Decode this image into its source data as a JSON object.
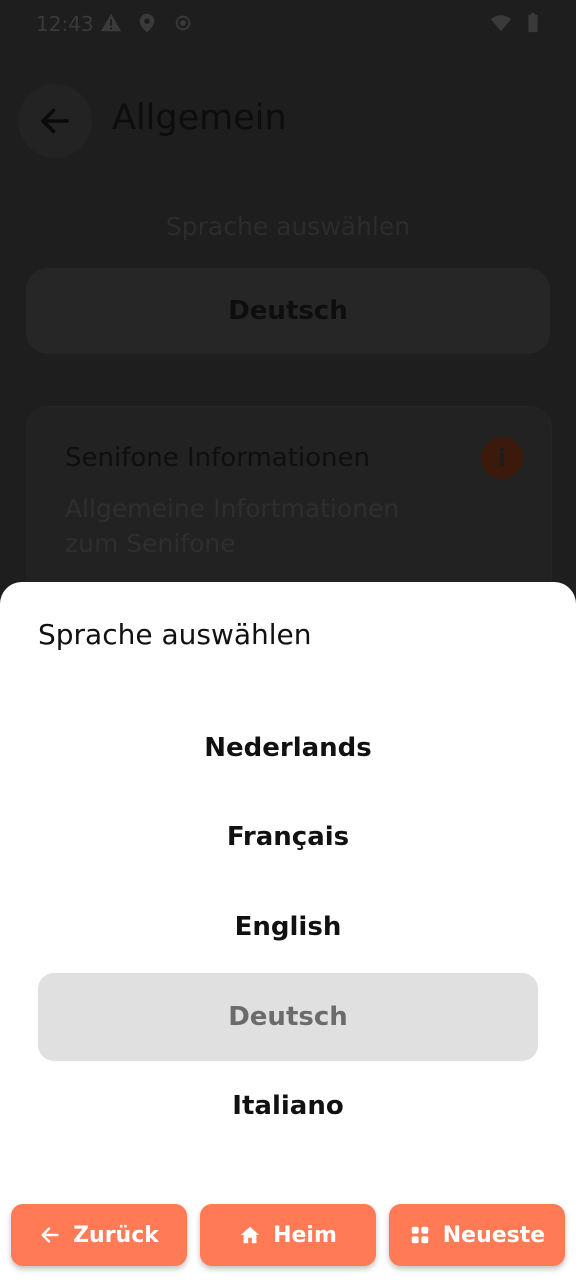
{
  "status_bar": {
    "time": "12:43",
    "icons": [
      "warning-icon",
      "location-icon",
      "gps-icon",
      "wifi-icon",
      "battery-icon"
    ]
  },
  "header": {
    "title": "Allgemein"
  },
  "settings": {
    "language_label": "Sprache auswählen",
    "language_value": "Deutsch",
    "info_card": {
      "title": "Senifone Informationen",
      "subtitle": "Allgemeine Infortmationen zum Senifone"
    }
  },
  "sheet": {
    "title": "Sprache auswählen",
    "options": [
      {
        "label": "Nederlands",
        "selected": false
      },
      {
        "label": "Français",
        "selected": false
      },
      {
        "label": "English",
        "selected": false
      },
      {
        "label": "Deutsch",
        "selected": true
      },
      {
        "label": "Italiano",
        "selected": false
      }
    ]
  },
  "bottom_nav": {
    "back_label": "Zurück",
    "home_label": "Heim",
    "recent_label": "Neueste"
  },
  "colors": {
    "accent": "#ff7a55",
    "selected_option_bg": "#e0e0e0",
    "scrim_bg": "#1e1e1e"
  }
}
